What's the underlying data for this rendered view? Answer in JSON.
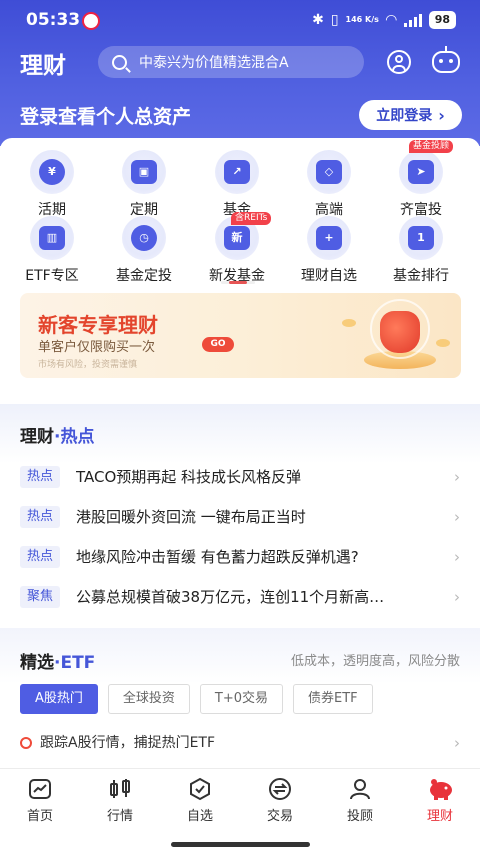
{
  "status_bar": {
    "time": "05:33",
    "network_speed": "146 K/s",
    "battery": "98"
  },
  "header": {
    "title": "理财",
    "search_placeholder": "中泰兴为价值精选混合A",
    "login_prompt": "登录查看个人总资产",
    "login_button": "立即登录"
  },
  "grid": {
    "items": [
      {
        "label": "活期",
        "icon": "current-deposit-icon",
        "glyph": "¥"
      },
      {
        "label": "定期",
        "icon": "fixed-deposit-icon",
        "glyph": "▣"
      },
      {
        "label": "基金",
        "icon": "fund-icon",
        "glyph": "↗"
      },
      {
        "label": "高端",
        "icon": "premium-icon",
        "glyph": "◇"
      },
      {
        "label": "齐富投",
        "icon": "qifutou-icon",
        "glyph": "➤",
        "badge": "基金投顾"
      },
      {
        "label": "ETF专区",
        "icon": "etf-zone-icon",
        "glyph": "▥"
      },
      {
        "label": "基金定投",
        "icon": "fund-plan-icon",
        "glyph": "◷"
      },
      {
        "label": "新发基金",
        "icon": "new-fund-icon",
        "glyph": "新",
        "badge": "含REITs"
      },
      {
        "label": "理财自选",
        "icon": "watchlist-icon",
        "glyph": "+"
      },
      {
        "label": "基金排行",
        "icon": "fund-rank-icon",
        "glyph": "1"
      }
    ]
  },
  "banner": {
    "title": "新客专享理财",
    "subtitle": "单客户仅限购买一次",
    "go_label": "GO",
    "risk_note": "市场有风险，投资需谨慎"
  },
  "hot": {
    "title_main": "理财",
    "title_accent": "·热点",
    "items": [
      {
        "tag": "热点",
        "text": "TACO预期再起 科技成长风格反弹"
      },
      {
        "tag": "热点",
        "text": "港股回暖外资回流 一键布局正当时"
      },
      {
        "tag": "热点",
        "text": "地缘风险冲击暂缓 有色蓄力超跌反弹机遇?"
      },
      {
        "tag": "聚焦",
        "text": "公募总规模首破38万亿元，连创11个月新高…"
      }
    ]
  },
  "etf": {
    "title_main": "精选",
    "title_accent": "·ETF",
    "description": "低成本，透明度高，风险分散",
    "chips": [
      "A股热门",
      "全球投资",
      "T+0交易",
      "债券ETF"
    ],
    "track_text": "跟踪A股行情，捕捉热门ETF"
  },
  "tabbar": {
    "items": [
      {
        "label": "首页",
        "icon": "home-icon"
      },
      {
        "label": "行情",
        "icon": "market-icon"
      },
      {
        "label": "自选",
        "icon": "watchlist-tab-icon"
      },
      {
        "label": "交易",
        "icon": "trade-icon"
      },
      {
        "label": "投顾",
        "icon": "advisor-icon"
      },
      {
        "label": "理财",
        "icon": "wealth-piggy-icon"
      }
    ],
    "active_color": "#e8333b"
  },
  "colors": {
    "brand": "#4f5de3",
    "accent_red": "#e3452d"
  }
}
